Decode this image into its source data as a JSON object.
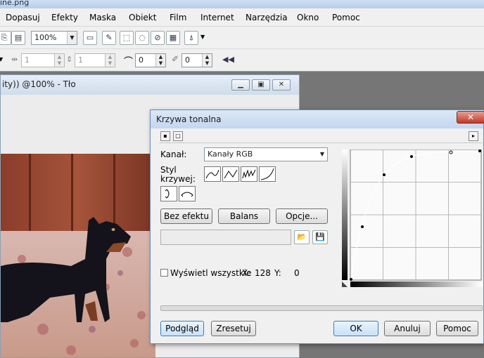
{
  "app": {
    "title": "ine.png"
  },
  "menu": [
    "Dopasuj",
    "Efekty",
    "Maska",
    "Obiekt",
    "Film",
    "Internet",
    "Narzędzia",
    "Okno",
    "Pomoc"
  ],
  "toolbar": {
    "zoom": "100%",
    "field_w": "1",
    "field_h": "1",
    "field_a": "0",
    "field_b": "0"
  },
  "document": {
    "title": "ity)) @100% - Tło"
  },
  "dialog": {
    "title": "Krzywa tonalna",
    "channel_label": "Kanał:",
    "channel_value": "Kanały RGB",
    "style_label_1": "Styl",
    "style_label_2": "krzywej:",
    "btn_no_effect": "Bez efektu",
    "btn_balance": "Balans",
    "btn_options": "Opcje...",
    "checkbox_label": "Wyświetl wszystkie",
    "x_label": "X:",
    "x_value": "128",
    "y_label": "Y:",
    "y_value": "0",
    "btn_preview": "Podgląd",
    "btn_reset": "Zresetuj",
    "btn_ok": "OK",
    "btn_cancel": "Anuluj",
    "btn_help": "Pomoc"
  }
}
